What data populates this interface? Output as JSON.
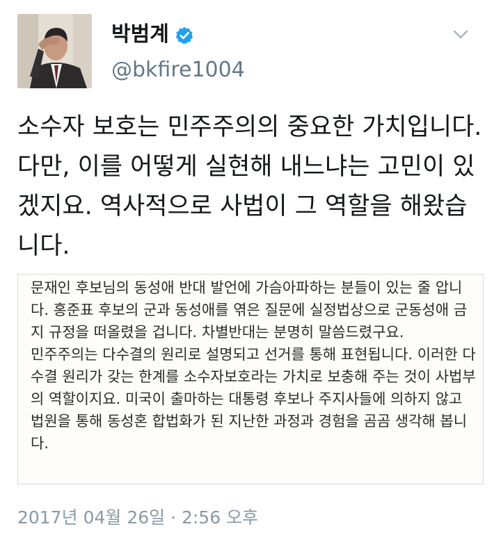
{
  "tweet": {
    "author": {
      "display_name": "박범계",
      "handle": "@bkfire1004",
      "verified": true
    },
    "text": "소수자 보호는 민주주의의 중요한 가치입니다. 다만, 이를 어떻게 실현해 내느냐는 고민이 있겠지요. 역사적으로 사법이 그 역할을 해왔습니다.",
    "attached_image_text": [
      "문재인 후보님의 동성애 반대 발언에 가슴아파하는 분들이 있는 줄 압니다. 홍준표 후보의 군과 동성애를 엮은 질문에 실정법상으로 군동성애 금지 규정을 떠올렸을 겁니다. 차별반대는 분명히 말씀드렸구요.",
      "민주주의는 다수결의 원리로 설명되고 선거를 통해 표현됩니다. 이러한 다수결 원리가 갖는 한계를 소수자보호라는 가치로 보충해 주는 것이 사법부의 역할이지요. 미국이 출마하는 대통령 후보나 주지사들에 의하지 않고 법원을 통해 동성혼 합법화가 된 지난한 과정과 경험을 곰곰 생각해 봅니다."
    ],
    "timestamp": "2017년 04월 26일 · 2:56 오후"
  },
  "icons": {
    "verified_badge": "verified-check-icon",
    "menu": "chevron-down-icon"
  },
  "colors": {
    "verified_blue": "#1da1f2",
    "secondary_text": "#657786",
    "timestamp_text": "#8899a6"
  }
}
